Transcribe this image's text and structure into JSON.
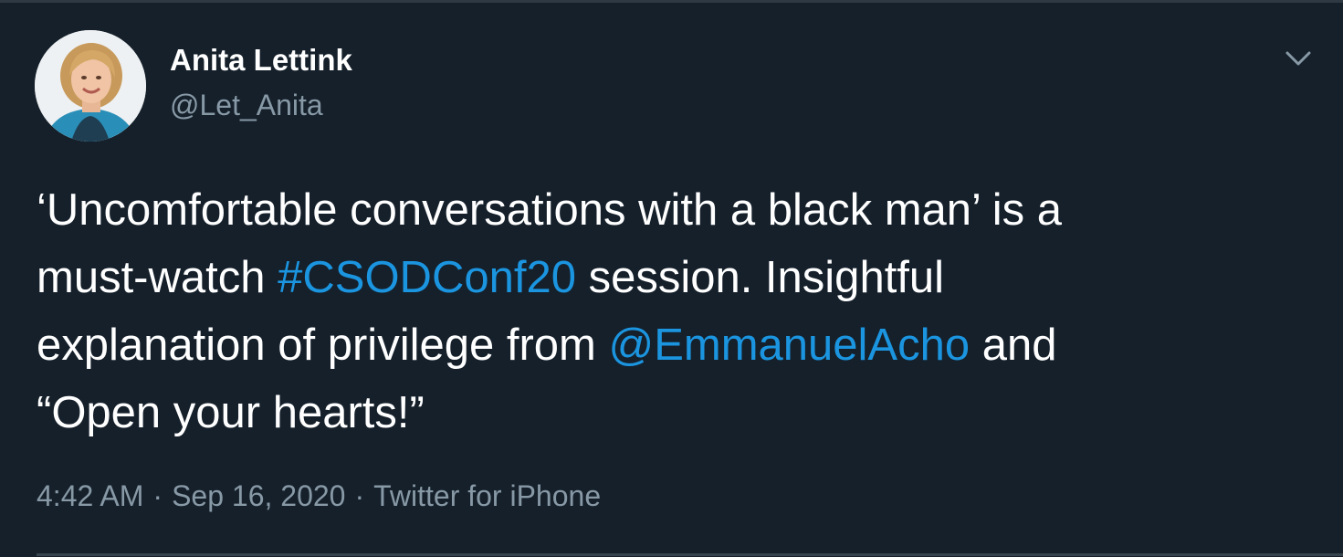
{
  "tweet": {
    "author": {
      "name": "Anita Lettink",
      "handle": "@Let_Anita"
    },
    "menu_icon": "chevron-down-icon",
    "text": {
      "line1": "‘Uncomfortable conversations with a black man’ is a",
      "line2_pre": "must-watch ",
      "hashtag": "#CSODConf20",
      "line2_post": " session. Insightful",
      "line3_pre": "explanation of privilege from ",
      "mention": "@EmmanuelAcho",
      "line3_post": " and",
      "line4": "“Open your hearts!”"
    },
    "meta": {
      "time": "4:42 AM",
      "date": "Sep 16, 2020",
      "separator": "·",
      "source": "Twitter for iPhone"
    }
  },
  "colors": {
    "background": "#15202b",
    "text": "#ffffff",
    "secondary": "#8899a6",
    "link": "#1b95e0"
  }
}
